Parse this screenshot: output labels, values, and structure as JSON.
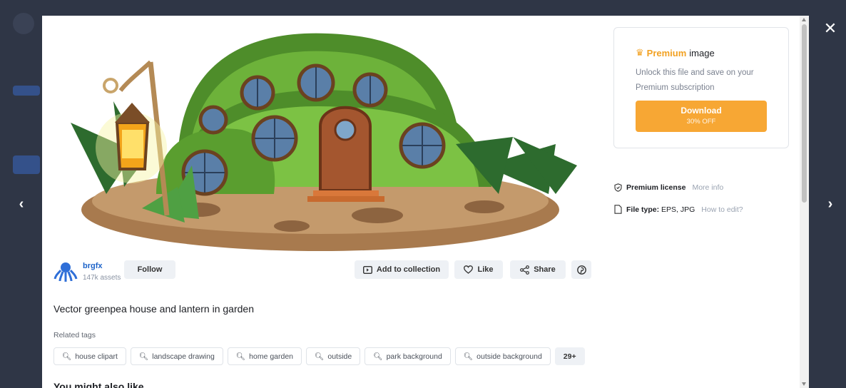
{
  "modal": {
    "close_label": "✕",
    "prev_label": "‹",
    "next_label": "›"
  },
  "author": {
    "name": "brgfx",
    "assets": "147k assets",
    "follow_label": "Follow"
  },
  "actions": {
    "add_to_collection": "Add to collection",
    "like": "Like",
    "share": "Share"
  },
  "resource": {
    "title": "Vector greenpea house and lantern in garden"
  },
  "related": {
    "label": "Related tags",
    "tags": [
      "house clipart",
      "landscape drawing",
      "home garden",
      "outside",
      "park background",
      "outside background"
    ],
    "more": "29+"
  },
  "section_heading": "You might also like",
  "premium": {
    "accent": "Premium",
    "title_rest": "image",
    "description": "Unlock this file and save on your Premium subscription",
    "download_label": "Download",
    "discount_label": "30% OFF",
    "accent_color": "#f7a734"
  },
  "license": {
    "label": "Premium license",
    "link": "More info"
  },
  "file": {
    "label": "File type:",
    "value": "EPS, JPG",
    "link": "How to edit?"
  }
}
